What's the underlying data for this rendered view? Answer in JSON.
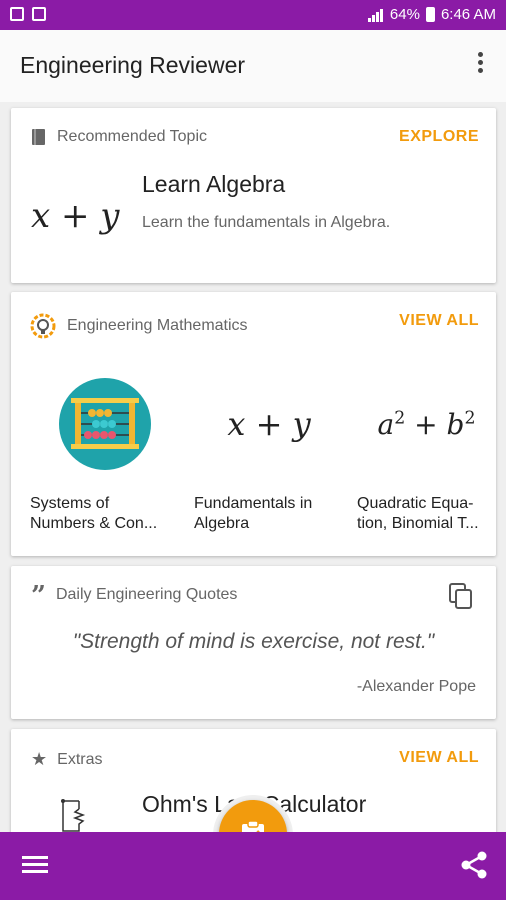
{
  "status": {
    "battery": "64%",
    "time": "6:46 AM"
  },
  "appbar": {
    "title": "Engineering Reviewer"
  },
  "recommended": {
    "header": "Recommended Topic",
    "action": "EXPLORE",
    "formula": "x + y",
    "title": "Learn Algebra",
    "description": "Learn the fundamentals in Algebra."
  },
  "mathematics": {
    "header": "Engineering Mathematics",
    "action": "VIEW ALL",
    "items": [
      {
        "icon": "abacus-icon",
        "line1": "Systems of",
        "line2": "Numbers & Con..."
      },
      {
        "formula": "x + y",
        "line1": "Fundamentals in",
        "line2": "Algebra"
      },
      {
        "formula_base1": "a",
        "formula_exp1": "2",
        "formula_op": " + ",
        "formula_base2": "b",
        "formula_exp2": "2",
        "line1": "Quadratic Equa-",
        "line2": "tion, Binomial T..."
      }
    ]
  },
  "quotes": {
    "header": "Daily Engineering Quotes",
    "text": "\"Strength of mind is exercise, not rest.\"",
    "author": "-Alexander Pope"
  },
  "extras": {
    "header": "Extras",
    "action": "VIEW ALL",
    "title": "Ohm's Law Calculator"
  },
  "colors": {
    "primary": "#8b1ba6",
    "accent": "#f29b0d"
  }
}
